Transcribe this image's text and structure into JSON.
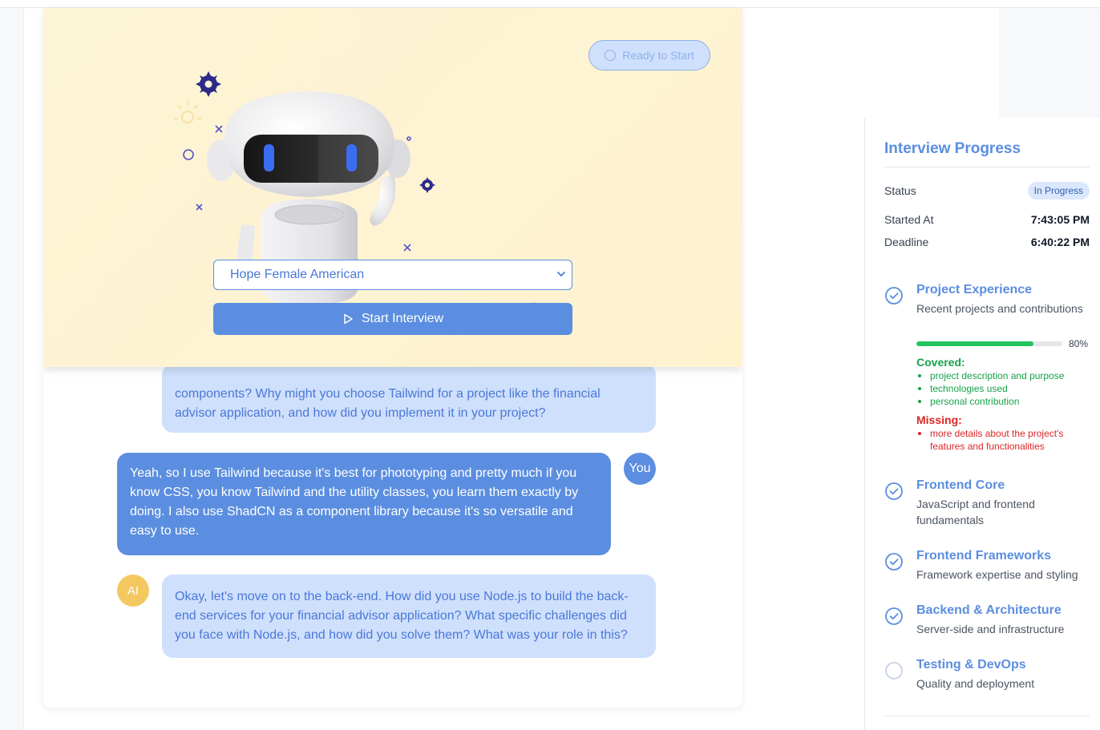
{
  "hero": {
    "status_label": "Ready to Start",
    "voice_selected": "Hope Female American",
    "start_label": "Start Interview"
  },
  "chat": {
    "messages": [
      {
        "role": "ai",
        "text": "components? Why might you choose Tailwind for a project like the financial advisor application, and how did you implement it in your project?"
      },
      {
        "role": "user",
        "avatar": "You",
        "text": "Yeah, so I use Tailwind because it's best for phototyping and pretty much if you know CSS, you know Tailwind and the utility classes, you learn them exactly by doing. I also use ShadCN as a component library because it's so versatile and easy to use."
      },
      {
        "role": "ai",
        "avatar": "AI",
        "text": "Okay, let's move on to the back-end. How did you use Node.js to build the back-end services for your financial advisor application? What specific challenges did you face with Node.js, and how did you solve them? What was your role in this?"
      }
    ]
  },
  "sidebar": {
    "title": "Interview Progress",
    "status_label": "Status",
    "status_value": "In Progress",
    "started_label": "Started At",
    "started_value": "7:43:05 PM",
    "deadline_label": "Deadline",
    "deadline_value": "6:40:22 PM",
    "topics": [
      {
        "name": "Project Experience",
        "desc": "Recent projects and contributions",
        "done": true,
        "progress": 80,
        "progress_label": "80%",
        "covered_label": "Covered:",
        "covered": [
          "project description and purpose",
          "technologies used",
          "personal contribution"
        ],
        "missing_label": "Missing:",
        "missing": [
          "more details about the project's features and functionalities"
        ]
      },
      {
        "name": "Frontend Core",
        "desc": "JavaScript and frontend fundamentals",
        "done": true
      },
      {
        "name": "Frontend Frameworks",
        "desc": "Framework expertise and styling",
        "done": true
      },
      {
        "name": "Backend & Architecture",
        "desc": "Server-side and infrastructure",
        "done": true
      },
      {
        "name": "Testing & DevOps",
        "desc": "Quality and deployment",
        "done": false
      }
    ]
  },
  "colors": {
    "accent": "#5b8ee0",
    "ai_bubble": "#cfe0fd",
    "covered": "#16a34a",
    "missing": "#dc2626",
    "progress": "#22c55e"
  }
}
